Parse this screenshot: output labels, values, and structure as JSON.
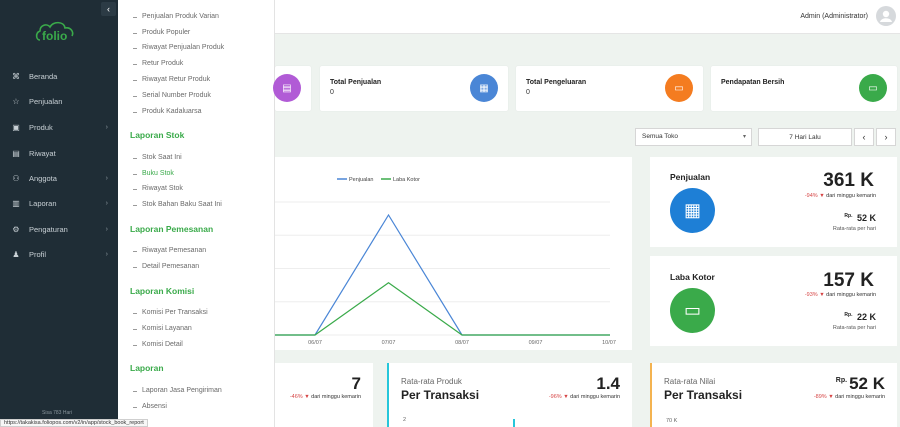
{
  "sidebar": {
    "items": [
      {
        "label": "Beranda",
        "icon": "grid-icon",
        "top": 0
      },
      {
        "label": "Penjualan",
        "icon": "star-icon"
      },
      {
        "label": "Produk",
        "icon": "box-icon",
        "has_children": true
      },
      {
        "label": "Riwayat",
        "icon": "book-icon"
      },
      {
        "label": "Anggota",
        "icon": "users-icon",
        "has_children": true
      },
      {
        "label": "Laporan",
        "icon": "bar-chart-icon",
        "has_children": true
      },
      {
        "label": "Pengaturan",
        "icon": "gear-icon",
        "has_children": true
      },
      {
        "label": "Profil",
        "icon": "user-icon",
        "has_children": true
      }
    ],
    "footer": "Sisa 783 Hari"
  },
  "logo_text": "folio",
  "submenu": {
    "top_items": [
      "Penjualan Produk Varian",
      "Produk Populer",
      "Riwayat Penjualan Produk",
      "Retur Produk",
      "Riwayat Retur Produk",
      "Serial Number Produk",
      "Produk Kadaluarsa"
    ],
    "sections": [
      {
        "title": "Laporan Stok",
        "items": [
          "Stok Saat Ini",
          "Buku Stok",
          "Riwayat Stok",
          "Stok Bahan Baku Saat Ini"
        ]
      },
      {
        "title": "Laporan Pemesanan",
        "items": [
          "Riwayat Pemesanan",
          "Detail Pemesanan"
        ]
      },
      {
        "title": "Laporan Komisi",
        "items": [
          "Komisi Per Transaksi",
          "Komisi Layanan",
          "Komisi Detail"
        ]
      },
      {
        "title": "Laporan",
        "items": [
          "Laporan Jasa Pengiriman",
          "Absensi"
        ]
      }
    ],
    "active_item": "Buku Stok"
  },
  "header": {
    "user": "Admin (Administrator)"
  },
  "stats": [
    {
      "title": "Total Penjualan",
      "value": "0",
      "color": "#4a86d6",
      "icon": "store-icon"
    },
    {
      "title": "Total Pengeluaran",
      "value": "0",
      "color": "#f47c20",
      "icon": "wallet-icon"
    },
    {
      "title": "Pendapatan Bersih",
      "value": "",
      "color": "#3aaa4a",
      "icon": "wallet-icon"
    }
  ],
  "filters": {
    "store": "Semua Toko",
    "range": "7 Hari Lalu",
    "prev": "‹",
    "next": "›"
  },
  "chart_data": {
    "type": "line",
    "x": [
      "06/07",
      "07/07",
      "08/07",
      "09/07",
      "10/07"
    ],
    "series": [
      {
        "name": "Penjualan",
        "color": "#4a86d6",
        "values": [
          0,
          361,
          0,
          0,
          0
        ]
      },
      {
        "name": "Laba Kotor",
        "color": "#3aaa4a",
        "values": [
          0,
          157,
          0,
          0,
          0
        ]
      }
    ],
    "legend": "top"
  },
  "cards": {
    "penjualan": {
      "title": "Penjualan",
      "big": "361 K",
      "delta_pct": "-94%",
      "delta_text": "dari minggu kemarin",
      "sub_prefix": "Rp.",
      "sub": "52 K",
      "note": "Rata-rata per hari"
    },
    "laba": {
      "title": "Laba Kotor",
      "big": "157 K",
      "delta_pct": "-93%",
      "delta_text": "dari minggu kemarin",
      "sub_prefix": "Rp.",
      "sub": "22 K",
      "note": "Rata-rata per hari"
    }
  },
  "bottom": [
    {
      "val": "7",
      "delta_pct": "-46%",
      "delta_text": "dari minggu kemarin"
    },
    {
      "t1": "Rata-rata Produk",
      "t2": "Per Transaksi",
      "val": "1.4",
      "delta_pct": "-96%",
      "delta_text": "dari minggu kemarin"
    },
    {
      "t1": "Rata-rata Nilai",
      "t2": "Per Transaksi",
      "prefix": "Rp.",
      "val": "52 K",
      "delta_pct": "-89%",
      "delta_text": "dari minggu kemarin",
      "axis_label": "70 K"
    }
  ],
  "status_url": "https://takakisa.foliopos.com/v2/in/app/stock_book_report"
}
